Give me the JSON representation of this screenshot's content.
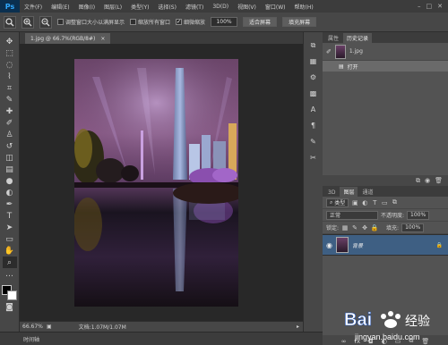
{
  "app": {
    "logo": "Ps"
  },
  "menu": [
    "文件(F)",
    "编辑(E)",
    "图像(I)",
    "图层(L)",
    "类型(Y)",
    "选择(S)",
    "滤镜(T)",
    "3D(D)",
    "视图(V)",
    "窗口(W)",
    "帮助(H)"
  ],
  "window_controls": [
    "–",
    "□",
    "✕"
  ],
  "options": {
    "resize_windows_label": "调整窗口大小以满屏显示",
    "zoom_all_label": "缩放所有窗口",
    "scrubby_zoom_label": "细微缩放",
    "zoom_value": "100%",
    "fit_screen_label": "适合屏幕",
    "fill_screen_label": "填充屏幕"
  },
  "document": {
    "tab_title": "1.jpg @ 66.7%(RGB/8#)",
    "close_glyph": "×"
  },
  "status": {
    "zoom": "66.67%",
    "doc_size": "文档:1.07M/1.07M"
  },
  "timeline": {
    "label": "时间轴"
  },
  "history": {
    "tabs": [
      "属性",
      "历史记录"
    ],
    "snapshot_name": "1.jpg",
    "state_name": "打开"
  },
  "layers": {
    "tabs": [
      "3D",
      "图层",
      "通道"
    ],
    "filter_type": "类型",
    "blend_mode": "正常",
    "opacity_label": "不透明度:",
    "opacity_value": "100%",
    "lock_label": "锁定:",
    "fill_label": "填充:",
    "fill_value": "100%",
    "layer_name": "背景"
  },
  "watermark": {
    "brand": "Bai度经验",
    "url": "jingyan.baidu.com"
  },
  "colors": {
    "foreground": "#000000",
    "background": "#ffffff",
    "selected_layer": "#3e5f83"
  }
}
